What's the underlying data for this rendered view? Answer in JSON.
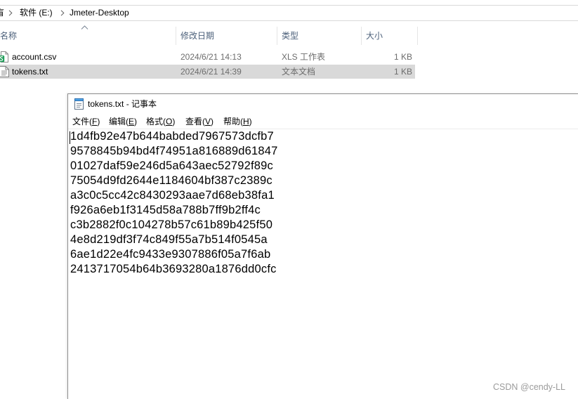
{
  "explorer": {
    "breadcrumb": [
      {
        "label": "盲"
      },
      {
        "label": "软件 (E:)"
      },
      {
        "label": "Jmeter-Desktop"
      }
    ],
    "breadcrumb_separator_icon": "chevron-right-icon",
    "columns": [
      {
        "label": "名称"
      },
      {
        "label": "修改日期"
      },
      {
        "label": "类型"
      },
      {
        "label": "大小"
      }
    ],
    "sort": {
      "column": "名称",
      "direction": "ascending",
      "icon": "sort-up-icon"
    },
    "files": [
      {
        "name": "account.csv",
        "modified": "2024/6/21 14:13",
        "type": "XLS 工作表",
        "size": "1 KB",
        "icon": "csv-file-icon",
        "selected": false
      },
      {
        "name": "tokens.txt",
        "modified": "2024/6/21 14:39",
        "type": "文本文档",
        "size": "1 KB",
        "icon": "text-file-icon",
        "selected": true
      }
    ]
  },
  "notepad": {
    "title": "tokens.txt - 记事本",
    "icon": "notepad-icon",
    "menu": [
      {
        "label": "文件(F)"
      },
      {
        "label": "编辑(E)"
      },
      {
        "label": "格式(O)"
      },
      {
        "label": "查看(V)"
      },
      {
        "label": "帮助(H)"
      }
    ],
    "lines": [
      "1d4fb92e47b644babded7967573dcfb7",
      "9578845b94bd4f74951a816889d61847",
      "01027daf59e246d5a643aec52792f89c",
      "75054d9fd2644e1184604bf387c2389c",
      "a3c0c5cc42c8430293aae7d68eb38fa1",
      "f926a6eb1f3145d58a788b7ff9b2ff4c",
      "c3b2882f0c104278b57c61b89b425f50",
      "4e8d219df3f74c849f55a7b514f0545a",
      "6ae1d22e4fc9433e9307886f05a7f6ab",
      "2413717054b64b3693280a1876dd0cfc"
    ]
  },
  "watermark": "CSDN @cendy-LL",
  "colors": {
    "header_text": "#4c607a",
    "secondary_text": "#6d6d6d",
    "selection": "#d9d9d9",
    "divider": "#e5e5e5",
    "csv_icon_green": "#1e9d58",
    "watermark": "#9b9b9b"
  }
}
